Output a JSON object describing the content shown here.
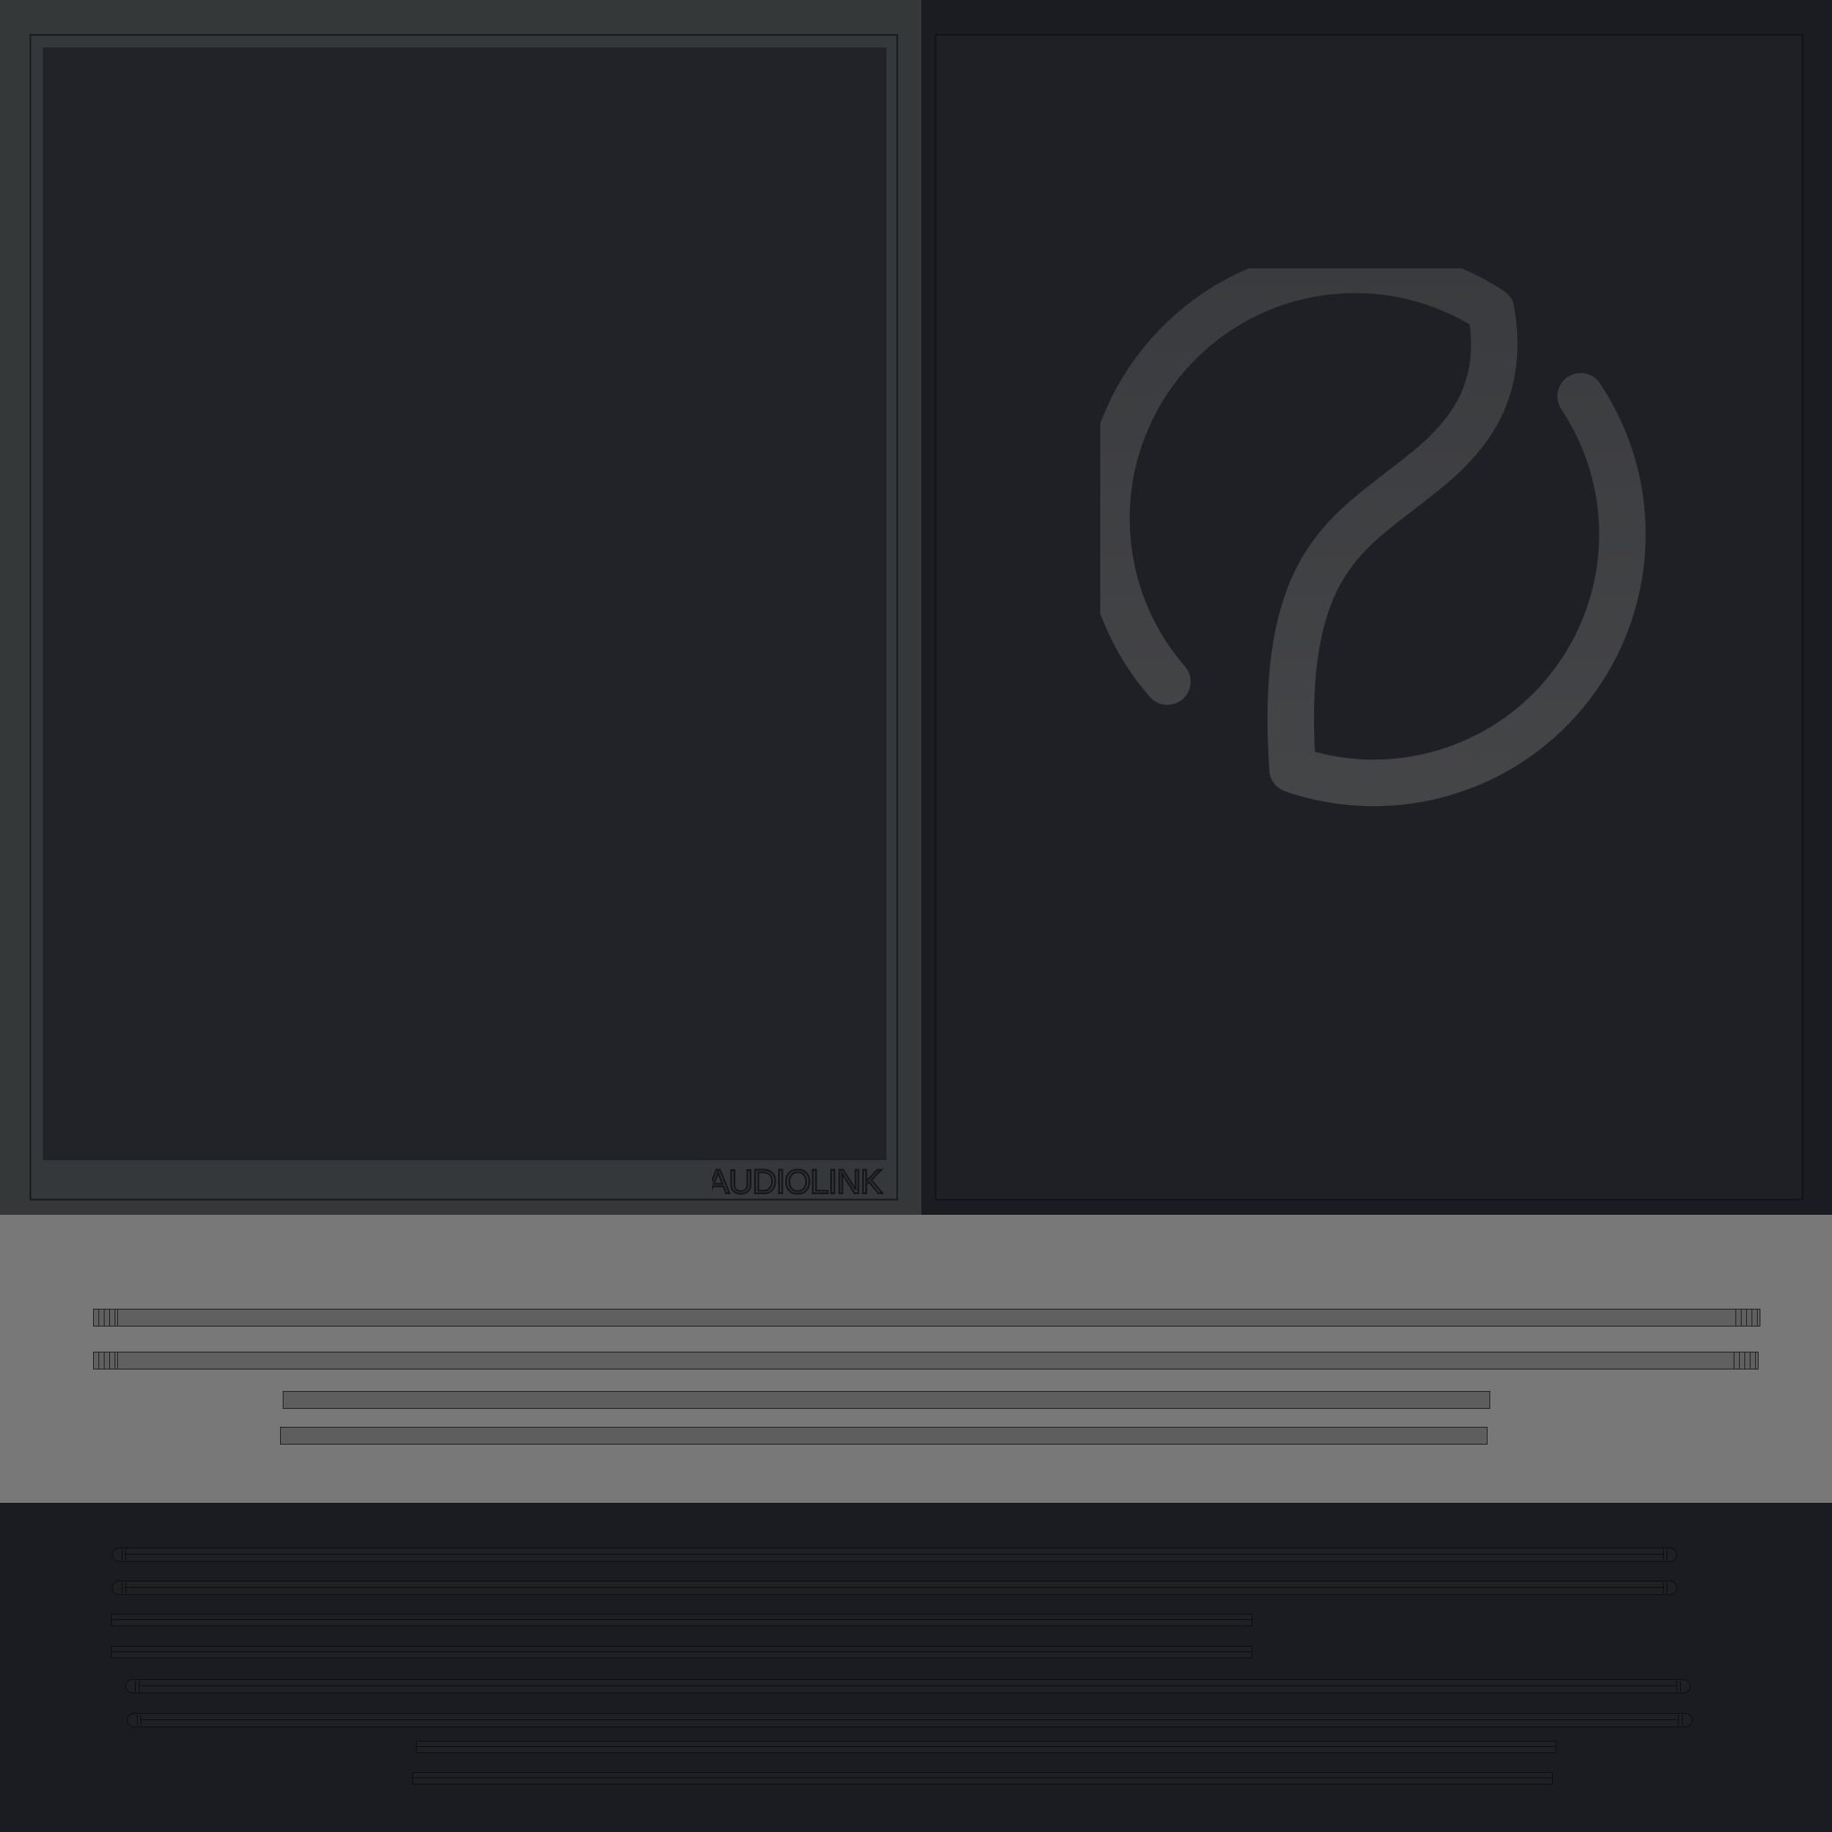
{
  "brand": {
    "logo_text": "AUDIOLINK"
  },
  "emblem": {
    "icon": "s-curve-circle-emblem",
    "color": "#3e3f42"
  },
  "colors": {
    "left_panel_bg": "#343839",
    "screen_bg": "#222328",
    "right_panel_bg": "#1f2025",
    "grey_band_bg": "#787878",
    "dark_band_bg": "#1a1c21"
  }
}
